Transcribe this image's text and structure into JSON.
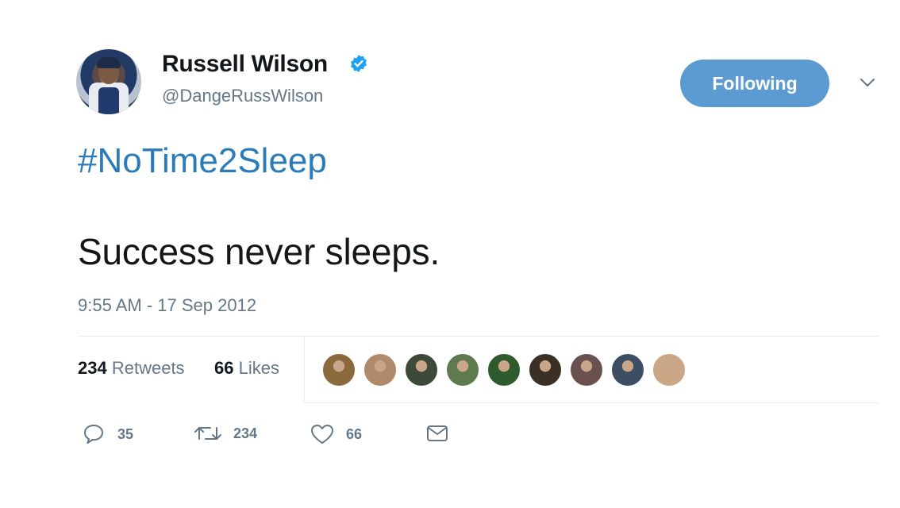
{
  "profile": {
    "name": "Russell Wilson",
    "handle": "@DangeRussWilson",
    "verified": true,
    "verified_color": "#1da1f2"
  },
  "follow_button": {
    "label": "Following",
    "color": "#5b9bd1"
  },
  "tweet": {
    "hashtag": "#NoTime2Sleep",
    "text": "Success never sleeps.",
    "timestamp": "9:55 AM - 17 Sep 2012"
  },
  "stats": {
    "retweets_count": "234",
    "retweets_label": "Retweets",
    "likes_count": "66",
    "likes_label": "Likes"
  },
  "likers": [
    {
      "icon": "liker-avatar-1",
      "color": "#8a6a3c"
    },
    {
      "icon": "liker-avatar-2",
      "color": "#b08a6a"
    },
    {
      "icon": "liker-avatar-3",
      "color": "#3d4a3a"
    },
    {
      "icon": "liker-avatar-4",
      "color": "#5f7a4e"
    },
    {
      "icon": "liker-avatar-5",
      "color": "#2f5a2e"
    },
    {
      "icon": "liker-avatar-6",
      "color": "#3a3026"
    },
    {
      "icon": "liker-avatar-7",
      "color": "#6b5050"
    },
    {
      "icon": "liker-avatar-8",
      "color": "#3d4d63"
    },
    {
      "icon": "liker-avatar-9",
      "color": "#caa686"
    }
  ],
  "actions": {
    "reply_count": "35",
    "retweet_count": "234",
    "like_count": "66"
  },
  "colors": {
    "link": "#2b7bb9",
    "secondary_text": "#657786",
    "primary_text": "#14171a"
  }
}
